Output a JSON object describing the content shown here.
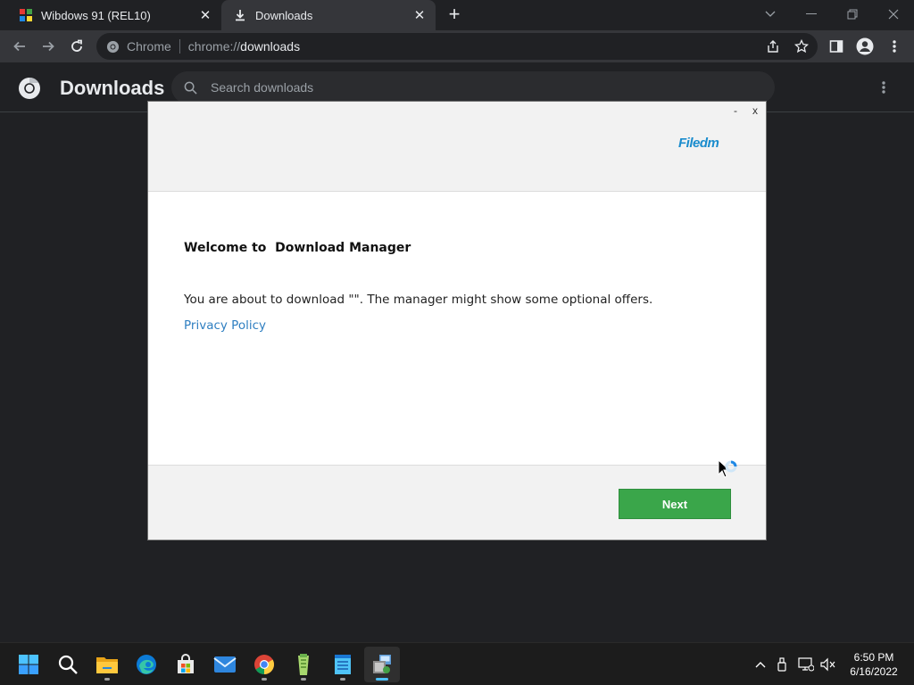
{
  "browser": {
    "tabs": [
      {
        "title": "Wibdows 91 (REL10)"
      },
      {
        "title": "Downloads"
      }
    ],
    "address": {
      "site_name": "Chrome",
      "url_scheme": "chrome://",
      "url_host": "downloads"
    }
  },
  "downloads_page": {
    "title": "Downloads",
    "search_placeholder": "Search downloads"
  },
  "dialog": {
    "min_label": "-",
    "close_label": "x",
    "brand": "Filedm",
    "heading": "Welcome to  Download Manager",
    "message": "You are about to download \"\". The manager might show some optional offers.",
    "privacy_link": "Privacy Policy",
    "next_button": "Next"
  },
  "taskbar": {
    "apps": [
      "start-icon",
      "search-icon",
      "file-explorer-icon",
      "edge-icon",
      "store-icon",
      "mail-icon",
      "chrome-icon",
      "notepad-plus-icon",
      "notepad-icon",
      "installer-icon"
    ],
    "clock_time": "6:50 PM",
    "clock_date": "6/16/2022"
  },
  "colors": {
    "accent_green": "#3aa64a",
    "brand_blue": "#1a8ccd",
    "link_blue": "#2f7fc1"
  }
}
